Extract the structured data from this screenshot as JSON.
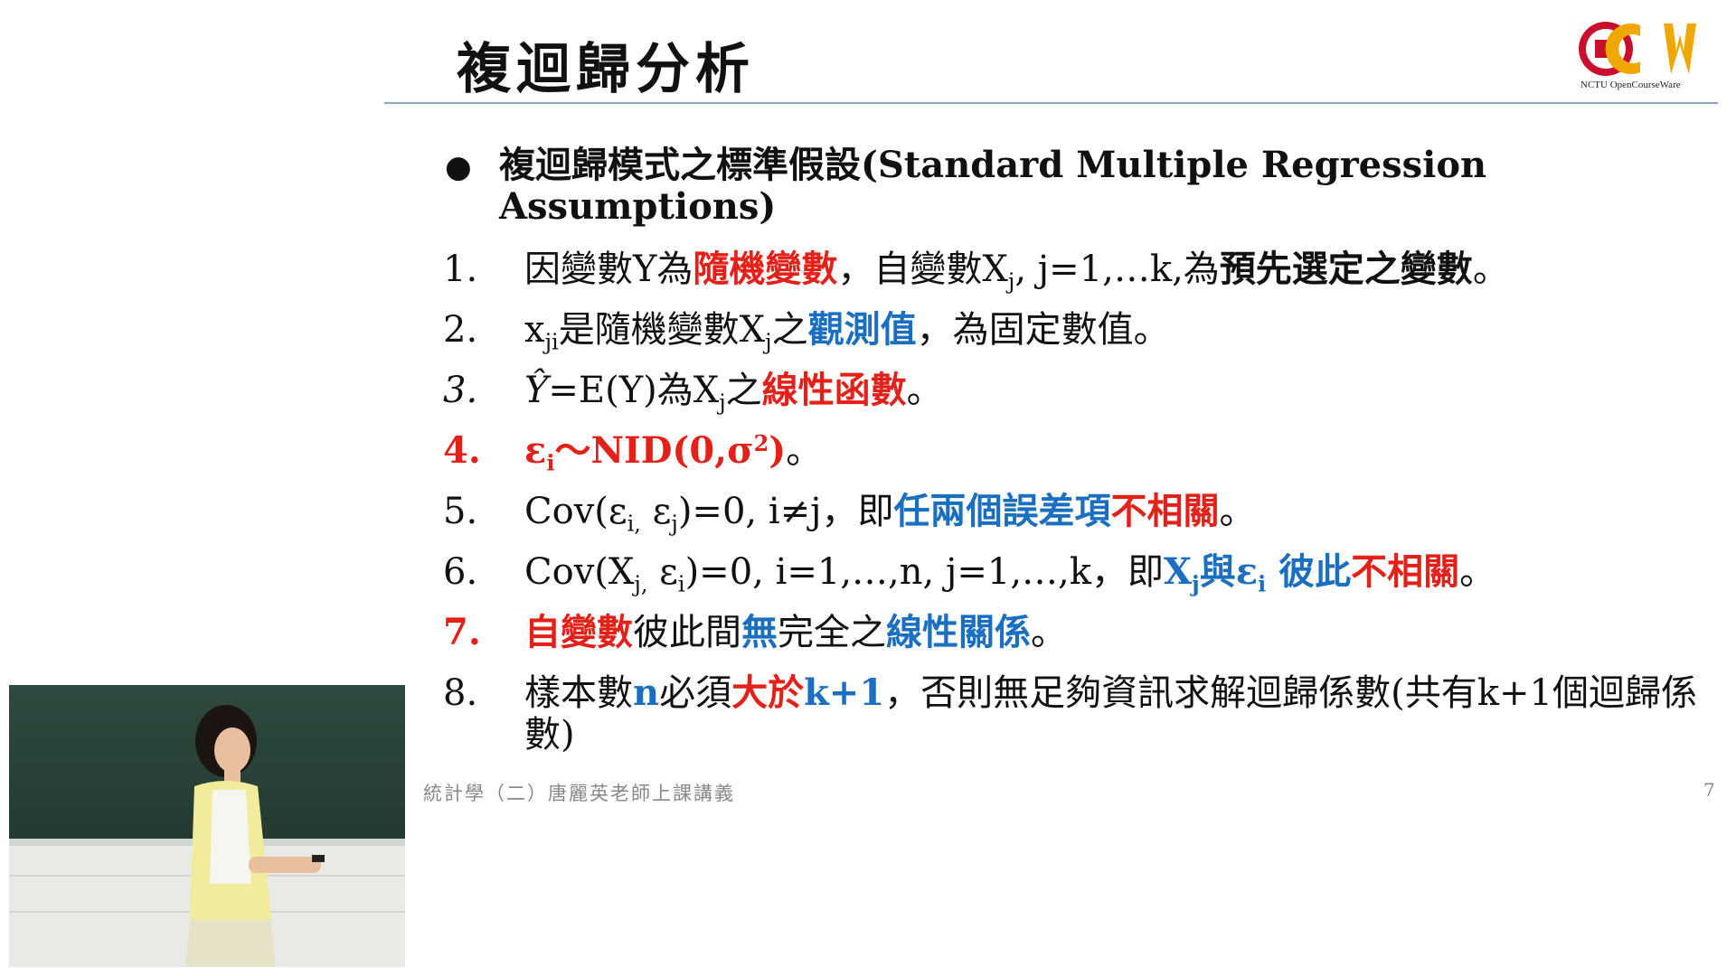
{
  "slide": {
    "title": "複迴歸分析",
    "logo_text": "NCTU OpenCourseWare",
    "bullet_heading": "複迴歸模式之標準假設(Standard Multiple Regression Assumptions)",
    "bullet_symbol": "●",
    "items": [
      {
        "num": "1.",
        "p1": "因變數Y為",
        "h1": "隨機變數",
        "p2": "，自變數X",
        "sub1": "j",
        "p3": ", j=1,…k,為",
        "h2": "預先選定之變數",
        "p4": "。"
      },
      {
        "num": "2.",
        "p0": "x",
        "sub0": "ji",
        "p1": "是隨機變數X",
        "sub1": "j",
        "p2": "之",
        "h1": "觀測值",
        "p3": "，為固定數值。"
      },
      {
        "num": "3.",
        "yhat": "Ŷ",
        "p1": "=E(Y)為X",
        "sub1": "j",
        "p2": "之",
        "h1": "線性函數",
        "p3": "。"
      },
      {
        "num": "4.",
        "h0": "ε",
        "sub0": "i",
        "h1": "～NID(0,σ",
        "sup1": "2",
        "h2": ")",
        "p1": "。"
      },
      {
        "num": "5.",
        "p1": "Cov(ε",
        "sub1": "i,",
        "p2": " ε",
        "sub2": "j",
        "p3": ")=0, i≠j，即",
        "h1": "任兩個誤差項",
        "h2": "不相關",
        "p4": "。"
      },
      {
        "num": "6.",
        "p1": "Cov(X",
        "sub1": "j,",
        "p2": " ε",
        "sub2": "i",
        "p3": ")=0, i=1,…,n, j=1,…,k，即",
        "h1": "X",
        "hsub1": "j",
        "h2": "與ε",
        "hsub2": "i",
        "h3": " 彼此",
        "h4": "不相關",
        "p4": "。"
      },
      {
        "num": "7.",
        "h1": "自變數",
        "p1": "彼此間",
        "h2": "無",
        "p2": "完全之",
        "h3": "線性關係",
        "p3": "。"
      },
      {
        "num": "8.",
        "p1": "樣本數",
        "h1": "n",
        "p2": "必須",
        "h2": "大於",
        "h3": "k+1",
        "p3": "，否則無足夠資訊求解迴歸係數(共有k+1個迴歸係數)"
      }
    ],
    "footer_left": "統計學（二）唐麗英老師上課講義",
    "page_number": "7"
  },
  "colors": {
    "highlight_red": "#e32119",
    "highlight_blue": "#1a6fc0",
    "title_rule": "#8aa6c4",
    "logo_red": "#c8102e",
    "logo_gold": "#f0a800"
  }
}
